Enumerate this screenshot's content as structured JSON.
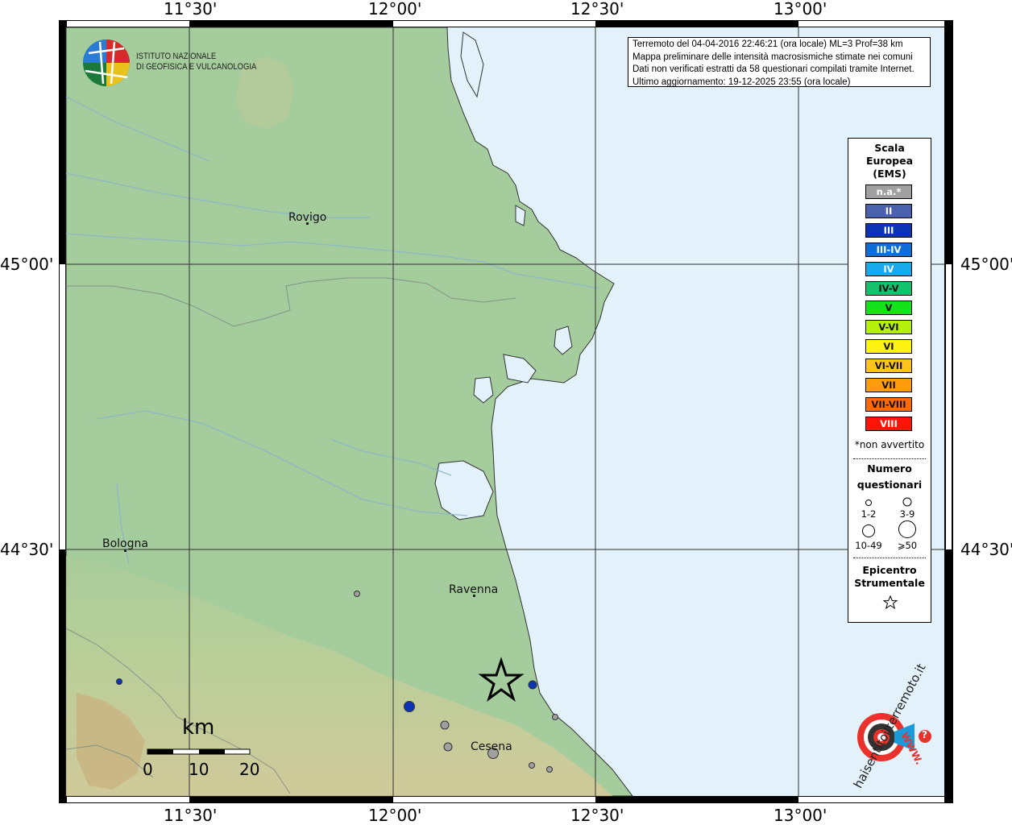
{
  "axes": {
    "lon_labels": [
      "11°30'",
      "12°00'",
      "12°30'",
      "13°00'"
    ],
    "lat_labels": [
      "45°00'",
      "44°30'"
    ]
  },
  "institute": {
    "line1": "ISTITUTO NAZIONALE",
    "line2": "DI GEOFISICA E VULCANOLOGIA"
  },
  "info": {
    "line1": "Terremoto del 04-04-2016 22:46:21 (ora locale) ML=3 Prof=38 km",
    "line2": "Mappa preliminare delle intensità macrosismiche stimate nei comuni",
    "line3": "Dati non verificati estratti da 58 questionari compilati tramite Internet.",
    "line4": "Ultimo aggiornamento: 19-12-2025 23:55 (ora locale)"
  },
  "towns": {
    "rovigo": "Rovigo",
    "bologna": "Bologna",
    "ravenna": "Ravenna",
    "cesena": "Cesena"
  },
  "scalebar": {
    "title": "km",
    "t0": "0",
    "t1": "10",
    "t2": "20"
  },
  "legend": {
    "title1": "Scala",
    "title2": "Europea",
    "title3": "(EMS)",
    "classes": [
      {
        "label": "n.a.*",
        "color": "#a0a0a0",
        "text": "#ffffff"
      },
      {
        "label": "II",
        "color": "#4a62ad",
        "text": "#ffffff"
      },
      {
        "label": "III",
        "color": "#0c33b3",
        "text": "#ffffff"
      },
      {
        "label": "III-IV",
        "color": "#0d6ed8",
        "text": "#ffffff"
      },
      {
        "label": "IV",
        "color": "#18a8ec",
        "text": "#ffffff"
      },
      {
        "label": "IV-V",
        "color": "#16c16e",
        "text": "#111111"
      },
      {
        "label": "V",
        "color": "#14e21b",
        "text": "#111111"
      },
      {
        "label": "V-VI",
        "color": "#b4f00c",
        "text": "#111111"
      },
      {
        "label": "VI",
        "color": "#fff312",
        "text": "#111111"
      },
      {
        "label": "VI-VII",
        "color": "#ffc41c",
        "text": "#111111"
      },
      {
        "label": "VII",
        "color": "#ff9c0e",
        "text": "#111111"
      },
      {
        "label": "VII-VIII",
        "color": "#ff6a08",
        "text": "#111111"
      },
      {
        "label": "VIII",
        "color": "#ff1408",
        "text": "#ffffff"
      }
    ],
    "note": "*non avvertito",
    "count_title1": "Numero",
    "count_title2": "questionari",
    "size_labels": [
      "1-2",
      "3-9",
      "10-49",
      "⩾50"
    ],
    "epicenter_title1": "Epicentro",
    "epicenter_title2": "Strumentale"
  },
  "site_logo": {
    "text": "haisentitoilterremoto.it",
    "www": "WWW.",
    "question": "?"
  }
}
